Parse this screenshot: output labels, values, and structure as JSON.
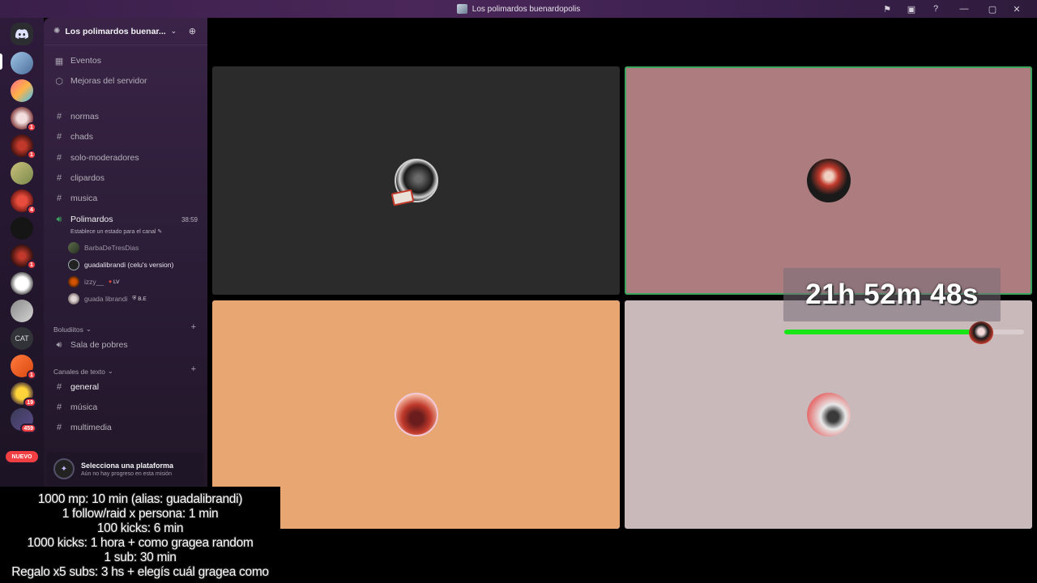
{
  "window": {
    "title": "Los polimardos buenardopolis"
  },
  "rail": {
    "nuevo_label": "NUEVO",
    "cat_label": "CAT",
    "badges": [
      "1",
      "1",
      "4",
      "1",
      "1",
      "19",
      "459"
    ]
  },
  "guild": {
    "name": "Los polimardos buenar...",
    "top_items": [
      {
        "label": "Eventos"
      },
      {
        "label": "Mejoras del servidor"
      }
    ],
    "channels": [
      {
        "label": "normas"
      },
      {
        "label": "chads"
      },
      {
        "label": "solo-moderadores"
      },
      {
        "label": "clipardos"
      },
      {
        "label": "musica"
      }
    ],
    "voice_channel": {
      "label": "Polimardos",
      "timer": "38:59",
      "status_hint": "Establece un estado para el canal",
      "users": [
        {
          "name": "BarbaDeTresDias",
          "tag": ""
        },
        {
          "name": "guadalibrandi (celu's version)",
          "tag": ""
        },
        {
          "name": "izzy__",
          "tag": "LV"
        },
        {
          "name": "guada librandi",
          "tag": "B.E"
        }
      ]
    },
    "categories": [
      {
        "label": "Boludiitos",
        "items": [
          {
            "label": "Sala de pobres"
          }
        ]
      },
      {
        "label": "Canales de texto",
        "items": [
          {
            "label": "general"
          },
          {
            "label": "música"
          },
          {
            "label": "multimedia"
          }
        ]
      }
    ],
    "quest": {
      "title": "Selecciona una plataforma",
      "subtitle": "Aún no hay progreso en esta misión"
    }
  },
  "overlay": {
    "lines": [
      "1000 mp: 10 min (alias: guadalibrandi)",
      "1 follow/raid x persona: 1 min",
      "100 kicks: 6 min",
      "1000 kicks: 1 hora + como gragea random",
      "1 sub: 30 min",
      "Regalo x5 subs: 3 hs + elegís cuál gragea como"
    ],
    "countdown": "21h 52m 48s",
    "progress": 0.82
  },
  "colors": {
    "tile1": "#2b2b2b",
    "tile2": "#ad7c7e",
    "tile3": "#e8a672",
    "tile4": "#c9b9bb",
    "speaking_border": "#3ba55d",
    "progress_green": "#19e619"
  }
}
